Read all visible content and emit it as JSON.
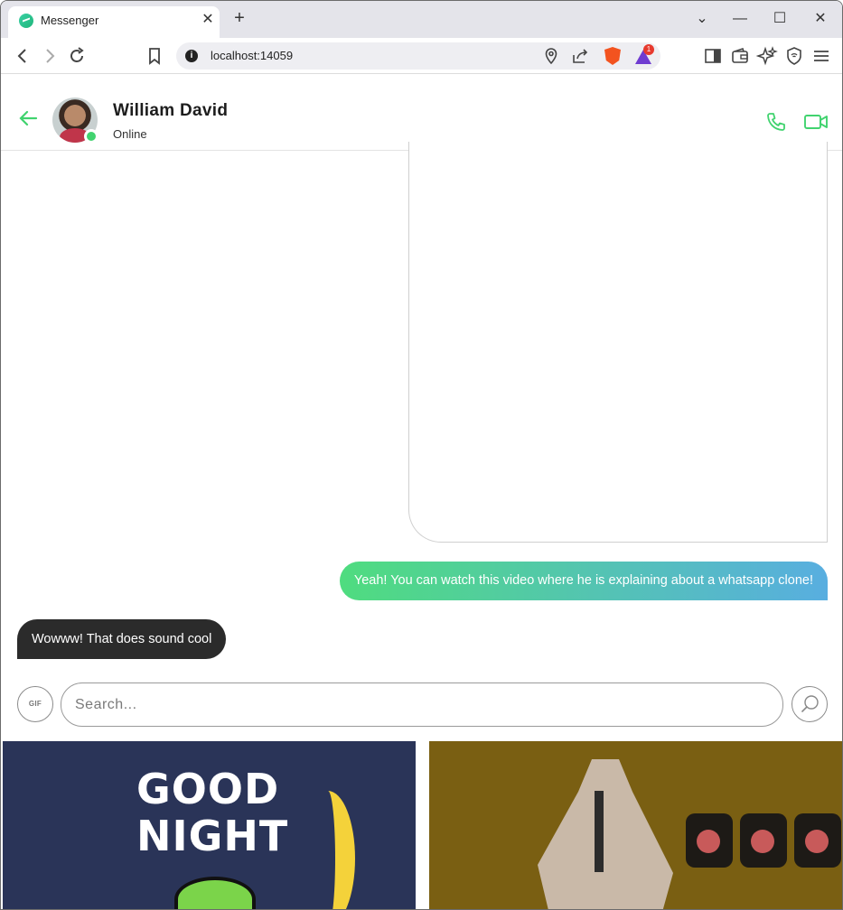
{
  "browser": {
    "tab_title": "Messenger",
    "tab_close": "✕",
    "new_tab": "+",
    "url": "localhost:14059",
    "rewards_badge": "1",
    "window_controls": {
      "tab_search": "⌄",
      "minimize": "—",
      "maximize": "☐",
      "close": "✕"
    }
  },
  "header": {
    "contact_name": "William David",
    "status": "Online",
    "accent_color": "#41d36f"
  },
  "messages": [
    {
      "direction": "outgoing",
      "text": "Yeah! You can watch this video where he is explaining about a whatsapp clone!"
    },
    {
      "direction": "incoming",
      "text": "Wowww! That does sound cool"
    }
  ],
  "gif_search": {
    "toggle_label": "GIF",
    "placeholder": "Search...",
    "value": ""
  },
  "gif_results": [
    {
      "lines": [
        "GOOD",
        "NIGHT"
      ],
      "background": "#2a3458"
    },
    {
      "lines": [],
      "background": "#7a5f12"
    }
  ]
}
